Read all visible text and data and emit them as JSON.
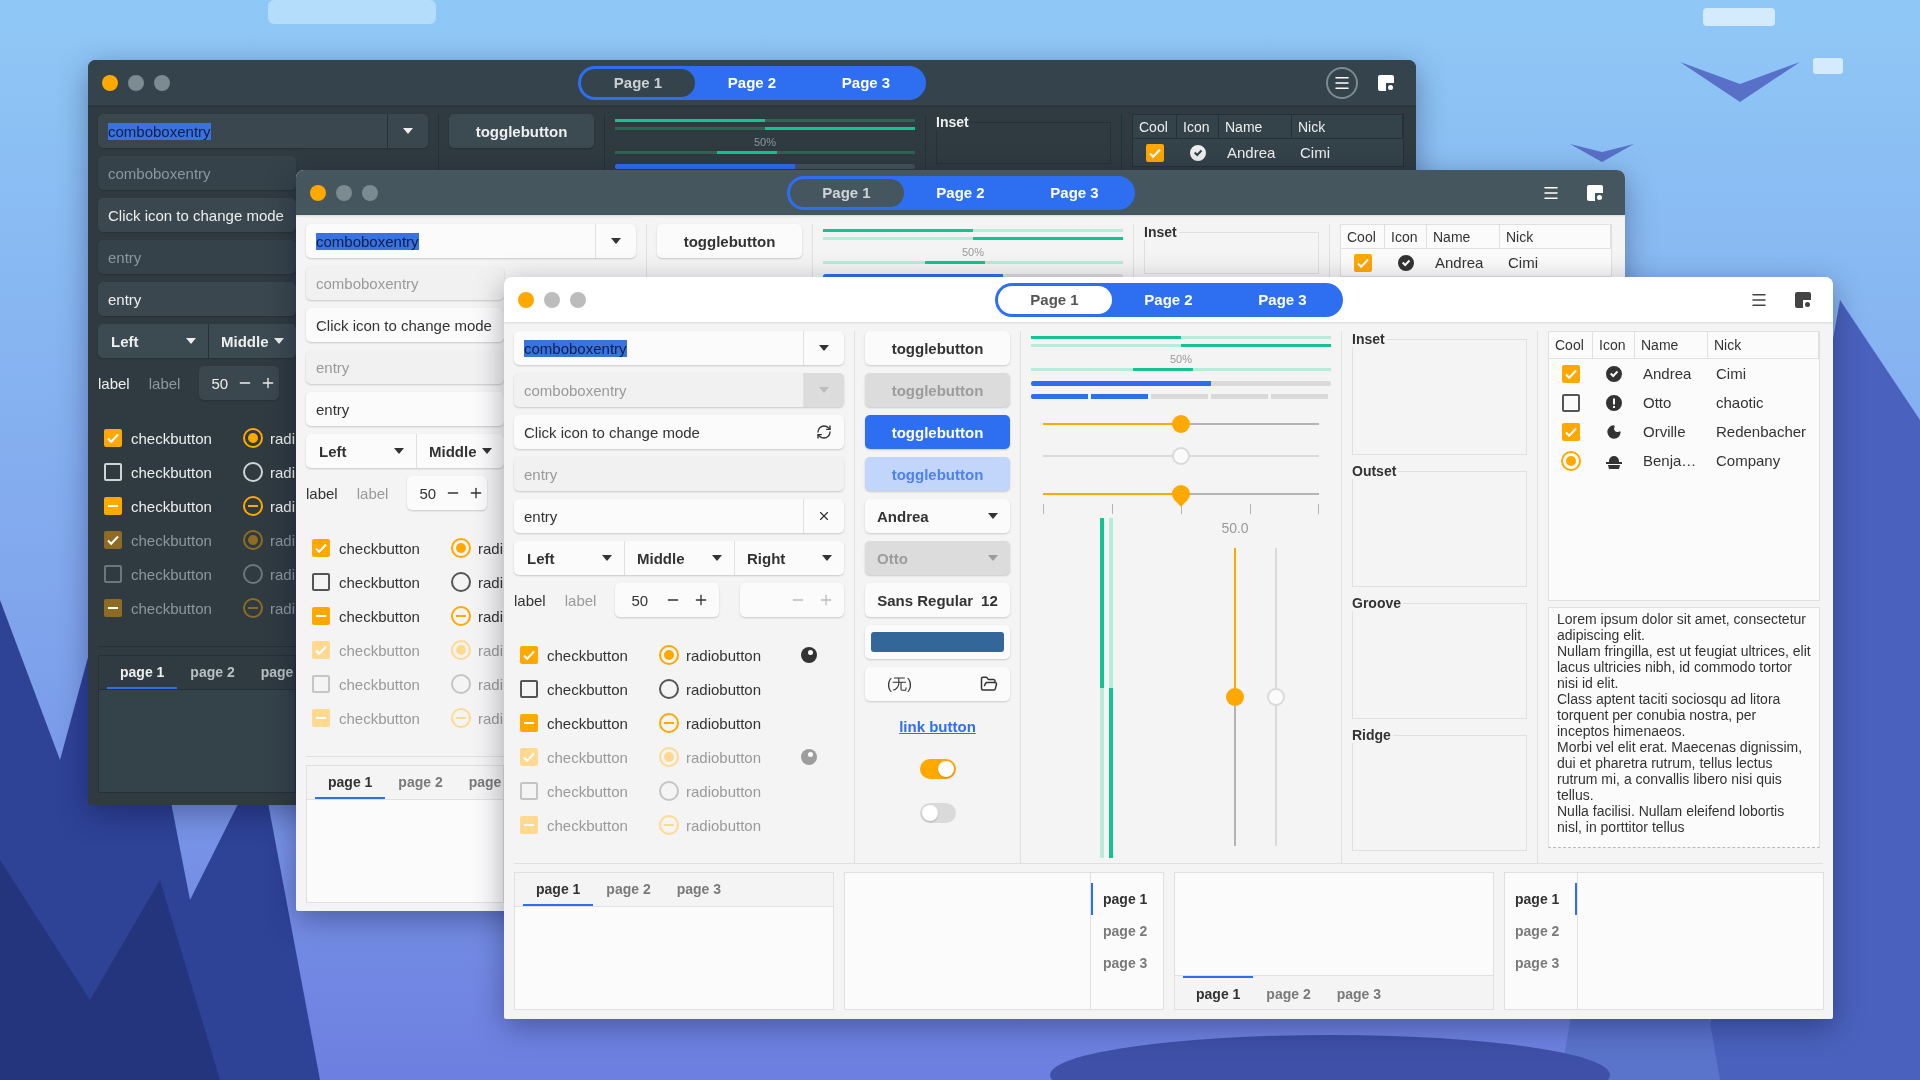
{
  "windows": [
    {
      "switcher": [
        {
          "label": "Page 1",
          "selected": true
        },
        {
          "label": "Page 2",
          "selected": false
        },
        {
          "label": "Page 3",
          "selected": false
        }
      ],
      "menu_pressed": true,
      "fields": [
        {
          "kind": "combo",
          "value": "comboboxentry",
          "highlighted": true,
          "disabled": false
        },
        {
          "kind": "combo",
          "value": "comboboxentry",
          "highlighted": false,
          "disabled": true
        },
        {
          "kind": "mode",
          "value": "Click icon to change mode",
          "highlighted": false,
          "disabled": false
        },
        {
          "kind": "plain",
          "value": "entry",
          "highlighted": false,
          "disabled": true
        },
        {
          "kind": "clearable",
          "value": "entry",
          "highlighted": false,
          "disabled": false
        }
      ],
      "combos": [
        "Left",
        "Middle"
      ],
      "labels": [
        {
          "text": "label",
          "disabled": false
        },
        {
          "text": "label",
          "disabled": true
        }
      ],
      "spins": [
        {
          "value": "50",
          "disabled": false
        }
      ],
      "checks": [
        {
          "kind": "check",
          "label": "checkbutton",
          "checked": true,
          "disabled": false
        },
        {
          "kind": "check",
          "label": "checkbutton",
          "checked": false,
          "disabled": false
        },
        {
          "kind": "mixed",
          "label": "checkbutton",
          "disabled": false
        },
        {
          "kind": "check",
          "label": "checkbutton",
          "checked": true,
          "disabled": true
        },
        {
          "kind": "check",
          "label": "checkbutton",
          "checked": false,
          "disabled": true
        },
        {
          "kind": "mixed",
          "label": "checkbutton",
          "disabled": true
        }
      ],
      "radios": [
        {
          "kind": "radio",
          "label": "radi",
          "checked": true,
          "disabled": false
        },
        {
          "kind": "radio",
          "label": "radi",
          "checked": false,
          "disabled": false
        },
        {
          "kind": "mixed",
          "label": "radi",
          "disabled": false
        },
        {
          "kind": "radio",
          "label": "radi",
          "checked": true,
          "disabled": true
        },
        {
          "kind": "radio",
          "label": "radi",
          "checked": false,
          "disabled": true
        },
        {
          "kind": "mixed",
          "label": "radi",
          "disabled": true
        }
      ],
      "toggles": [
        {
          "kind": "toggle",
          "label": "togglebutton",
          "active": false,
          "disabled": false
        }
      ],
      "progress": [
        {
          "kind": "bar",
          "level": 0.5,
          "inverted": false
        },
        {
          "kind": "bar",
          "level": 0.5,
          "inverted": true
        },
        {
          "kind": "caption",
          "text": "50%"
        },
        {
          "kind": "pulse"
        },
        {
          "kind": "blue",
          "level": 0.6
        }
      ],
      "frames": [
        "Inset"
      ],
      "table": {
        "columns": [
          "Cool",
          "Icon",
          "Name",
          "Nick"
        ],
        "rows": [
          {
            "kind": "check",
            "checked": true,
            "name": "Andrea",
            "nick": "Cimi"
          }
        ]
      },
      "notebooks": [
        {
          "kind": "top",
          "tabs": [
            {
              "label": "page 1",
              "selected": true
            },
            {
              "label": "page 2",
              "selected": false
            },
            {
              "label": "page",
              "selected": false
            }
          ]
        }
      ]
    },
    {
      "switcher": [
        {
          "label": "Page 1",
          "selected": true
        },
        {
          "label": "Page 2",
          "selected": false
        },
        {
          "label": "Page 3",
          "selected": false
        }
      ],
      "menu_pressed": false,
      "fields": [
        {
          "kind": "combo",
          "value": "comboboxentry",
          "highlighted": true,
          "disabled": false
        },
        {
          "kind": "combo",
          "value": "comboboxentry",
          "highlighted": false,
          "disabled": true
        },
        {
          "kind": "mode",
          "value": "Click icon to change mode",
          "highlighted": false,
          "disabled": false
        },
        {
          "kind": "plain",
          "value": "entry",
          "highlighted": false,
          "disabled": true
        },
        {
          "kind": "clearable",
          "value": "entry",
          "highlighted": false,
          "disabled": false
        }
      ],
      "combos": [
        "Left",
        "Middle"
      ],
      "labels": [
        {
          "text": "label",
          "disabled": false
        },
        {
          "text": "label",
          "disabled": true
        }
      ],
      "spins": [
        {
          "value": "50",
          "disabled": false
        }
      ],
      "checks": [
        {
          "kind": "check",
          "label": "checkbutton",
          "checked": true,
          "disabled": false
        },
        {
          "kind": "check",
          "label": "checkbutton",
          "checked": false,
          "disabled": false
        },
        {
          "kind": "mixed",
          "label": "checkbutton",
          "disabled": false
        },
        {
          "kind": "check",
          "label": "checkbutton",
          "checked": true,
          "disabled": true
        },
        {
          "kind": "check",
          "label": "checkbutton",
          "checked": false,
          "disabled": true
        },
        {
          "kind": "mixed",
          "label": "checkbutton",
          "disabled": true
        }
      ],
      "radios": [
        {
          "kind": "radio",
          "label": "radi",
          "checked": true,
          "disabled": false
        },
        {
          "kind": "radio",
          "label": "radi",
          "checked": false,
          "disabled": false
        },
        {
          "kind": "mixed",
          "label": "radi",
          "disabled": false
        },
        {
          "kind": "radio",
          "label": "radi",
          "checked": true,
          "disabled": true
        },
        {
          "kind": "radio",
          "label": "radi",
          "checked": false,
          "disabled": true
        },
        {
          "kind": "mixed",
          "label": "radi",
          "disabled": true
        }
      ],
      "toggles": [
        {
          "kind": "toggle",
          "label": "togglebutton",
          "active": false,
          "disabled": false
        }
      ],
      "progress": [
        {
          "kind": "bar",
          "level": 0.5,
          "inverted": false
        },
        {
          "kind": "bar",
          "level": 0.5,
          "inverted": true
        },
        {
          "kind": "caption",
          "text": "50%"
        },
        {
          "kind": "pulse"
        },
        {
          "kind": "blue",
          "level": 0.6
        }
      ],
      "frames": [
        "Inset"
      ],
      "table": {
        "columns": [
          "Cool",
          "Icon",
          "Name",
          "Nick"
        ],
        "rows": [
          {
            "kind": "check",
            "checked": true,
            "name": "Andrea",
            "nick": "Cimi"
          }
        ]
      },
      "notebooks": [
        {
          "kind": "top",
          "tabs": [
            {
              "label": "page 1",
              "selected": true
            },
            {
              "label": "page 2",
              "selected": false
            },
            {
              "label": "page",
              "selected": false
            }
          ]
        }
      ]
    },
    {
      "switcher": [
        {
          "label": "Page 1",
          "selected": true
        },
        {
          "label": "Page 2",
          "selected": false
        },
        {
          "label": "Page 3",
          "selected": false
        }
      ],
      "menu_pressed": false,
      "fields": [
        {
          "kind": "combo",
          "value": "comboboxentry",
          "highlighted": true,
          "disabled": false
        },
        {
          "kind": "combo",
          "value": "comboboxentry",
          "highlighted": false,
          "disabled": true
        },
        {
          "kind": "mode",
          "value": "Click icon to change mode",
          "highlighted": false,
          "disabled": false
        },
        {
          "kind": "plain",
          "value": "entry",
          "highlighted": false,
          "disabled": true
        },
        {
          "kind": "clearable",
          "value": "entry",
          "highlighted": false,
          "disabled": false
        }
      ],
      "combos": [
        "Left",
        "Middle",
        "Right"
      ],
      "labels": [
        {
          "text": "label",
          "disabled": false
        },
        {
          "text": "label",
          "disabled": true
        }
      ],
      "spins": [
        {
          "value": "50",
          "disabled": false
        },
        {
          "disabled": true
        }
      ],
      "checks": [
        {
          "kind": "check",
          "label": "checkbutton",
          "checked": true,
          "disabled": false
        },
        {
          "kind": "check",
          "label": "checkbutton",
          "checked": false,
          "disabled": false
        },
        {
          "kind": "mixed",
          "label": "checkbutton",
          "disabled": false
        },
        {
          "kind": "check",
          "label": "checkbutton",
          "checked": true,
          "disabled": true
        },
        {
          "kind": "check",
          "label": "checkbutton",
          "checked": false,
          "disabled": true
        },
        {
          "kind": "mixed",
          "label": "checkbutton",
          "disabled": true
        }
      ],
      "radios": [
        {
          "kind": "radio",
          "label": "radiobutton",
          "checked": true,
          "disabled": false
        },
        {
          "kind": "radio",
          "label": "radiobutton",
          "checked": false,
          "disabled": false
        },
        {
          "kind": "mixed",
          "label": "radiobutton",
          "disabled": false
        },
        {
          "kind": "radio",
          "label": "radiobutton",
          "checked": true,
          "disabled": true
        },
        {
          "kind": "radio",
          "label": "radiobutton",
          "checked": false,
          "disabled": true
        },
        {
          "kind": "mixed",
          "label": "radiobutton",
          "disabled": true
        }
      ],
      "bare_radios": [
        {
          "disabled": false
        },
        {
          "disabled": true
        }
      ],
      "toggles": [
        {
          "kind": "toggle",
          "label": "togglebutton",
          "active": false,
          "disabled": false
        },
        {
          "kind": "toggle",
          "label": "togglebutton",
          "active": false,
          "disabled": true
        },
        {
          "kind": "toggle",
          "label": "togglebutton",
          "active": true,
          "disabled": false
        },
        {
          "kind": "toggle",
          "label": "togglebutton",
          "active": true,
          "disabled": true
        },
        {
          "kind": "combo",
          "label": "Andrea",
          "disabled": false
        },
        {
          "kind": "combo",
          "label": "Otto",
          "disabled": true
        },
        {
          "kind": "font",
          "label": "Sans Regular",
          "size": "12"
        },
        {
          "kind": "color",
          "color": "#336699"
        },
        {
          "kind": "file",
          "label": "(无)"
        },
        {
          "kind": "link",
          "label": "link button"
        },
        {
          "kind": "switch",
          "on": true
        },
        {
          "kind": "switch",
          "on": false
        }
      ],
      "progress": [
        {
          "kind": "bar",
          "level": 0.5,
          "inverted": false
        },
        {
          "kind": "bar",
          "level": 0.5,
          "inverted": true
        },
        {
          "kind": "caption",
          "text": "50%"
        },
        {
          "kind": "pulse"
        },
        {
          "kind": "blue",
          "level": 0.6
        },
        {
          "kind": "segmented",
          "level": 0.4
        }
      ],
      "sliders": [
        {
          "kind": "plain",
          "level": 0.5,
          "disabled": false
        },
        {
          "kind": "plain",
          "level": 0.5,
          "disabled": true
        },
        {
          "kind": "marked",
          "level": 0.5,
          "disabled": false
        }
      ],
      "scale_value": "50.0",
      "vbars": [
        {
          "level": 0.5,
          "inverted": false
        },
        {
          "level": 0.5,
          "inverted": true
        }
      ],
      "vsliders": [
        {
          "level": 0.5,
          "disabled": false
        },
        {
          "level": 0.5,
          "disabled": true
        }
      ],
      "frames": [
        "Inset",
        "Outset",
        "Groove",
        "Ridge"
      ],
      "table": {
        "columns": [
          "Cool",
          "Icon",
          "Name",
          "Nick"
        ],
        "rows": [
          {
            "kind": "check",
            "checked": true,
            "name": "Andrea",
            "nick": "Cimi"
          },
          {
            "kind": "check",
            "checked": false,
            "name": "Otto",
            "nick": "chaotic"
          },
          {
            "kind": "check",
            "checked": true,
            "name": "Orville",
            "nick": "Redenbacher"
          },
          {
            "kind": "radio",
            "checked": true,
            "name": "Benja…",
            "nick": "Company"
          }
        ]
      },
      "text_view": [
        "Lorem ipsum dolor sit amet, consectetur adipiscing elit.",
        "Nullam fringilla, est ut feugiat ultrices, elit lacus ultricies nibh, id commodo tortor nisi id elit.",
        "Class aptent taciti sociosqu ad litora torquent per conubia nostra, per inceptos himenaeos.",
        "Morbi vel elit erat. Maecenas dignissim, dui et pharetra rutrum, tellus lectus rutrum mi, a convallis libero nisi quis tellus.",
        "Nulla facilisi. Nullam eleifend lobortis nisl, in porttitor tellus"
      ],
      "notebooks": [
        {
          "kind": "top",
          "tabs": [
            {
              "label": "page 1",
              "selected": true
            },
            {
              "label": "page 2",
              "selected": false
            },
            {
              "label": "page 3",
              "selected": false
            }
          ]
        },
        {
          "kind": "right",
          "tabs": [
            {
              "label": "page 1",
              "selected": true
            },
            {
              "label": "page 2",
              "selected": false
            },
            {
              "label": "page 3",
              "selected": false
            }
          ]
        },
        {
          "kind": "bottom",
          "tabs": [
            {
              "label": "page 1",
              "selected": true
            },
            {
              "label": "page 2",
              "selected": false
            },
            {
              "label": "page 3",
              "selected": false
            }
          ]
        },
        {
          "kind": "left",
          "tabs": [
            {
              "label": "page 1",
              "selected": true
            },
            {
              "label": "page 2",
              "selected": false
            },
            {
              "label": "page 3",
              "selected": false
            }
          ]
        }
      ]
    }
  ]
}
